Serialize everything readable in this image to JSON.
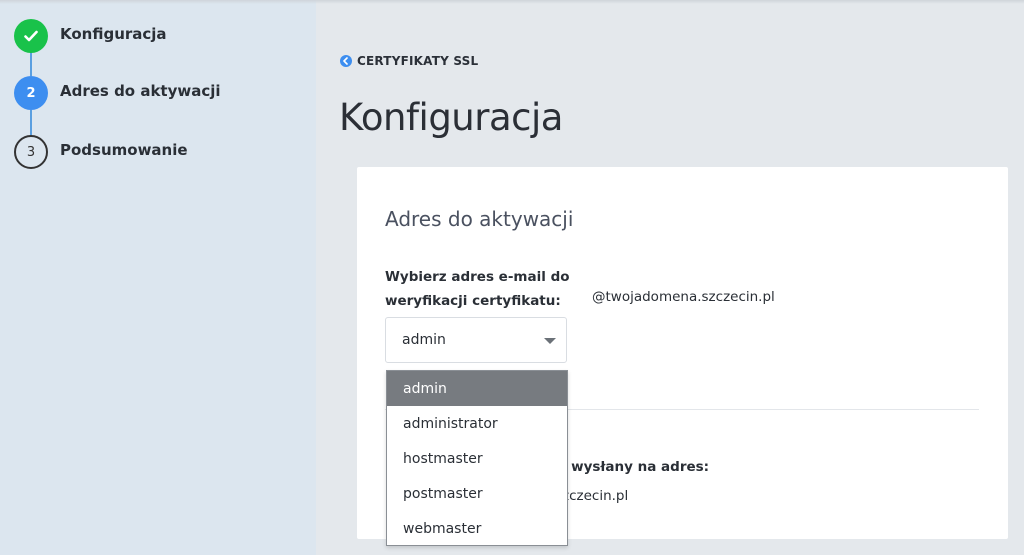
{
  "steps": [
    {
      "number": "",
      "label": "Konfiguracja",
      "state": "done"
    },
    {
      "number": "2",
      "label": "Adres do aktywacji",
      "state": "active"
    },
    {
      "number": "3",
      "label": "Podsumowanie",
      "state": "todo"
    }
  ],
  "breadcrumb": {
    "label": "CERTYFIKATY SSL"
  },
  "page": {
    "title": "Konfiguracja"
  },
  "card": {
    "section_title": "Adres do aktywacji",
    "field_label_line1": "Wybierz adres e-mail do",
    "field_label_line2": "weryfikacji certyfikatu:",
    "domain_suffix": "@twojadomena.szczecin.pl",
    "select_value": "admin",
    "info_label_partial": "nie wysłany na adres:",
    "info_value_partial": "zczecin.pl"
  },
  "dropdown": {
    "options": [
      "admin",
      "administrator",
      "hostmaster",
      "postmaster",
      "webmaster"
    ],
    "selected": "admin"
  },
  "colors": {
    "accent": "#3d8ef0",
    "success": "#19c24a",
    "sidebar_bg": "#dce6ef"
  }
}
